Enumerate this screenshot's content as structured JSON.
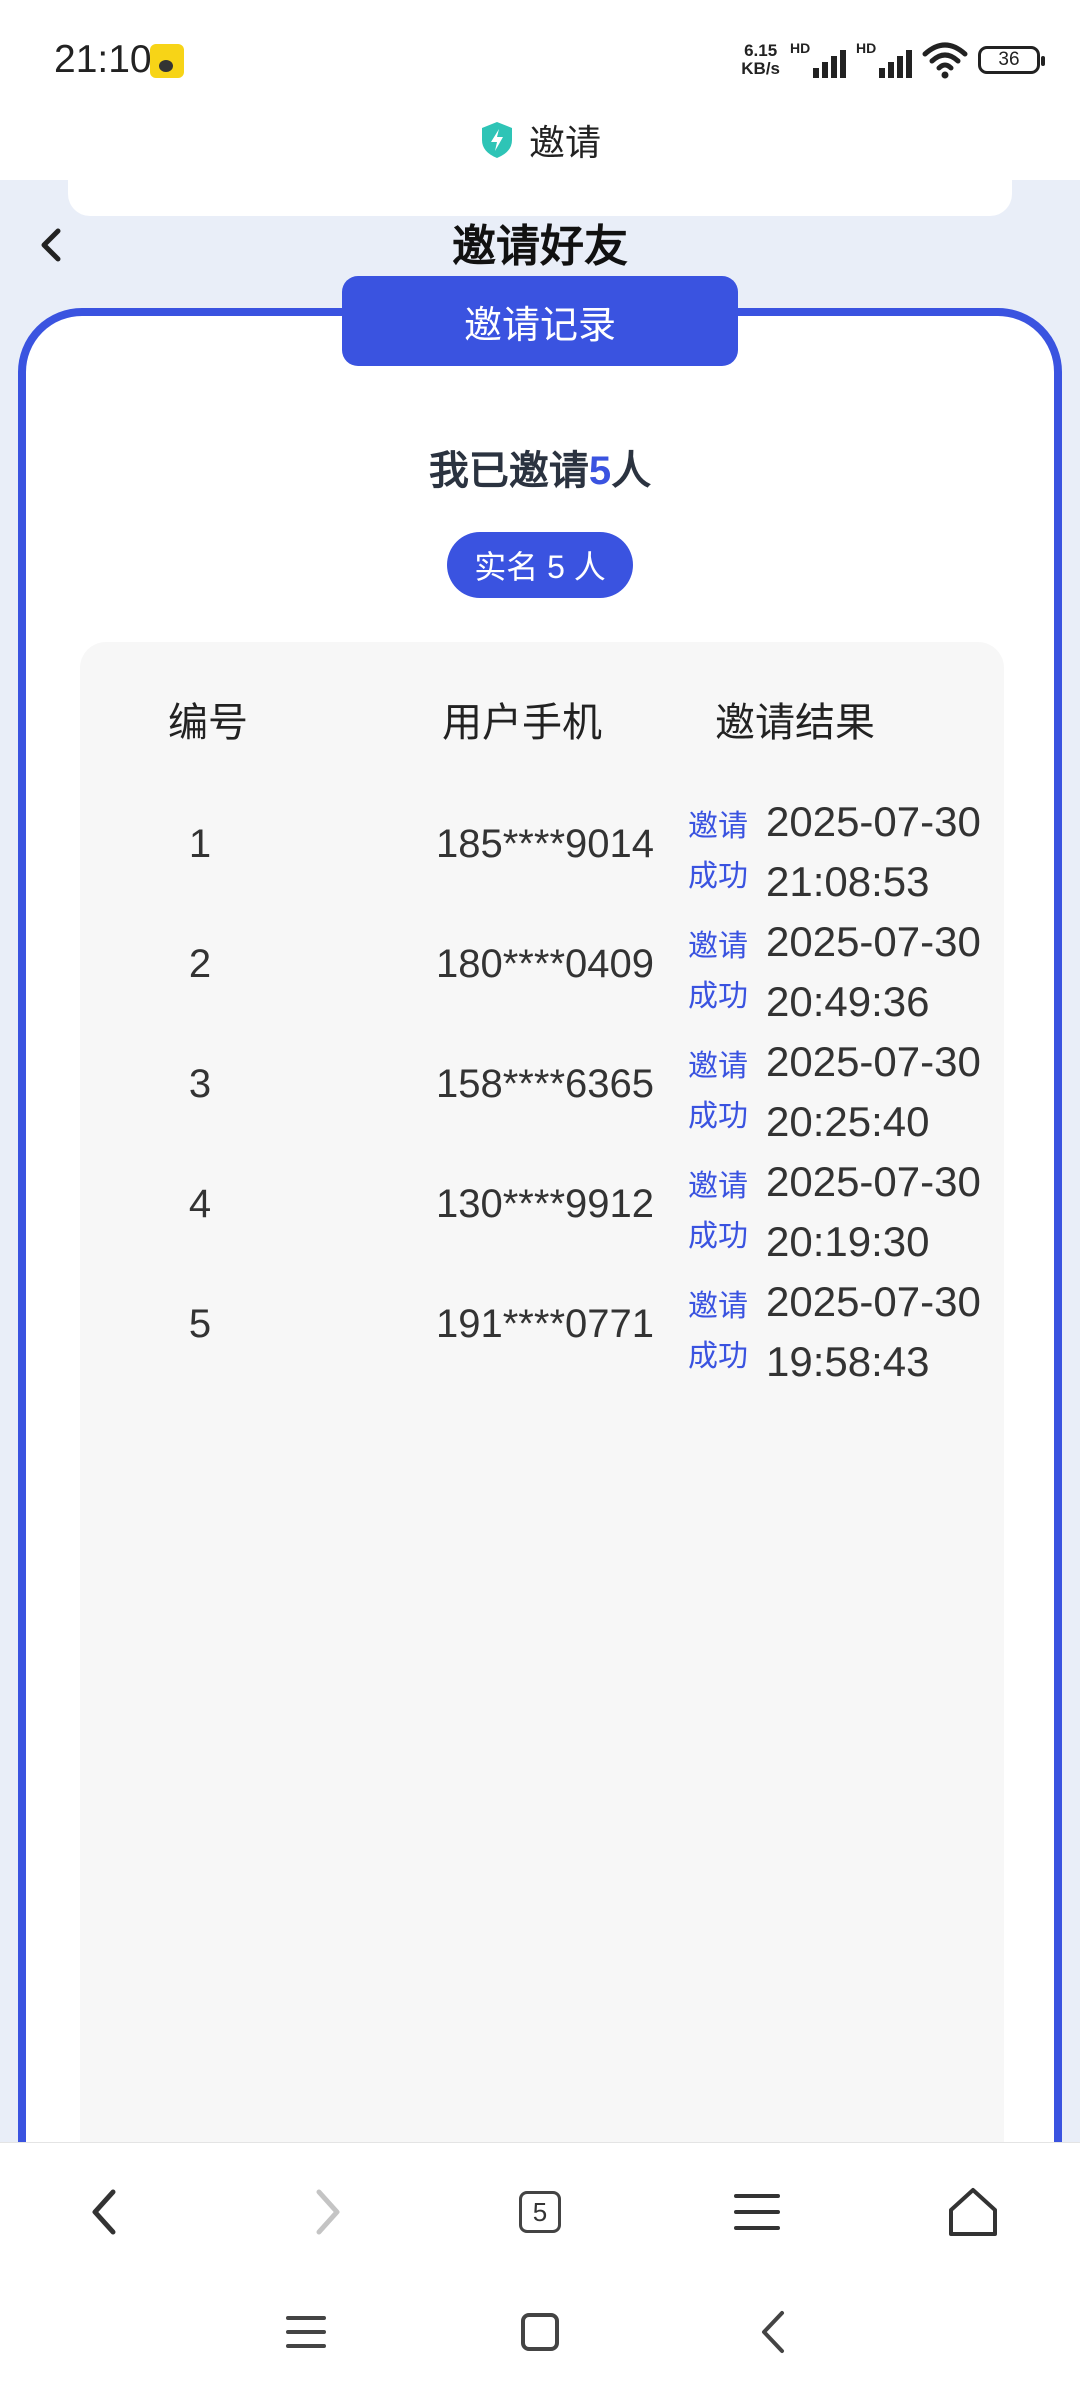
{
  "status_bar": {
    "time": "21:10",
    "net_speed_value": "6.15",
    "net_speed_unit": "KB/s",
    "signal_label": "HD",
    "battery_level": "36"
  },
  "browser": {
    "page_title": "邀请",
    "tab_count": "5"
  },
  "page": {
    "heading": "邀请好友",
    "record_tab_label": "邀请记录",
    "summary_prefix": "我已邀请",
    "summary_count": "5",
    "summary_suffix": "人",
    "verified_badge": "实名 5 人"
  },
  "table": {
    "headers": [
      "编号",
      "用户手机",
      "邀请结果"
    ],
    "rows": [
      {
        "no": "1",
        "phone": "185****9014",
        "status_line1": "邀请",
        "status_line2": "成功",
        "date": "2025-07-30",
        "time": "21:08:53"
      },
      {
        "no": "2",
        "phone": "180****0409",
        "status_line1": "邀请",
        "status_line2": "成功",
        "date": "2025-07-30",
        "time": "20:49:36"
      },
      {
        "no": "3",
        "phone": "158****6365",
        "status_line1": "邀请",
        "status_line2": "成功",
        "date": "2025-07-30",
        "time": "20:25:40"
      },
      {
        "no": "4",
        "phone": "130****9912",
        "status_line1": "邀请",
        "status_line2": "成功",
        "date": "2025-07-30",
        "time": "20:19:30"
      },
      {
        "no": "5",
        "phone": "191****0771",
        "status_line1": "邀请",
        "status_line2": "成功",
        "date": "2025-07-30",
        "time": "19:58:43"
      }
    ]
  },
  "colors": {
    "accent": "#3a53e0",
    "page_background": "#e9eef8",
    "table_background": "#f7f7f7",
    "shield": "#2ec4b6"
  },
  "icons": {
    "back": "chevron-left-icon",
    "shield": "shield-bolt-icon",
    "forward": "chevron-right-icon",
    "tabs": "tabs-count-icon",
    "menu": "hamburger-menu-icon",
    "home": "home-icon"
  }
}
